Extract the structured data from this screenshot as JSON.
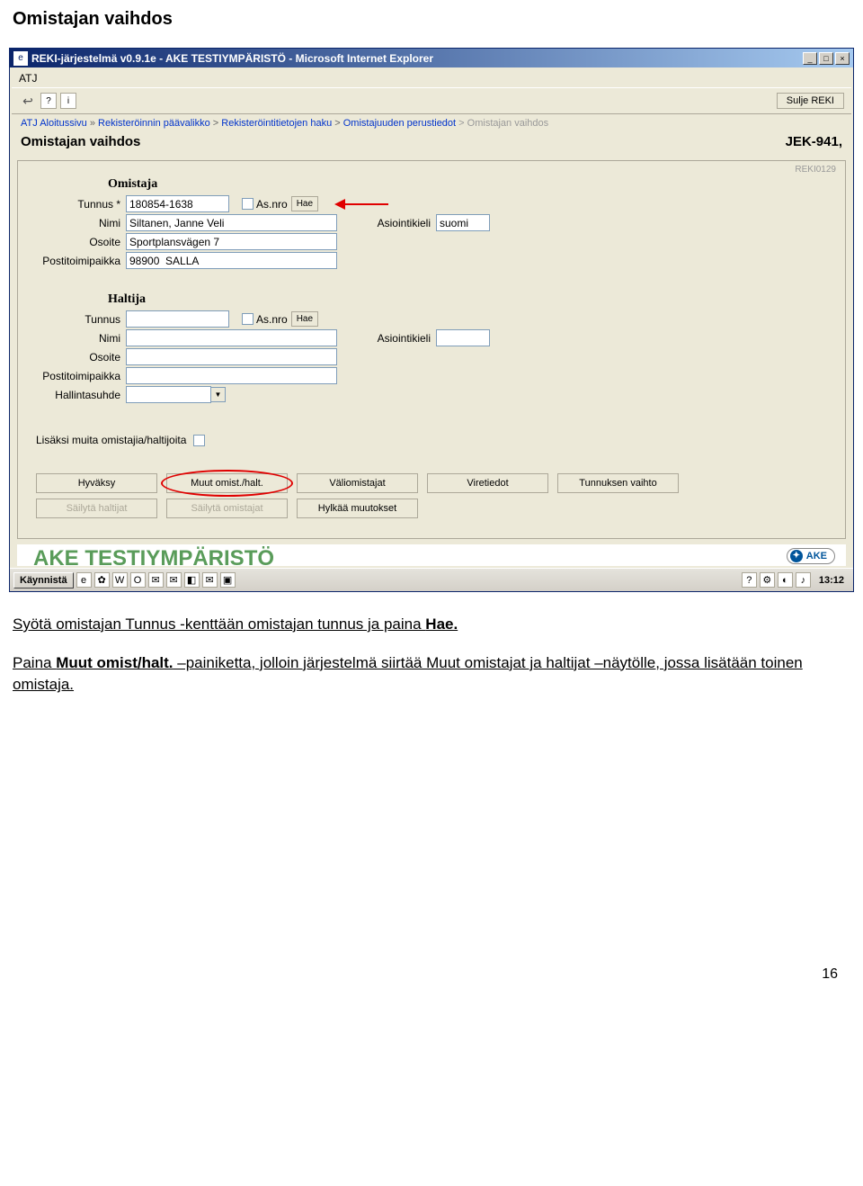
{
  "doc": {
    "heading": "Omistajan vaihdos",
    "page_number": "16"
  },
  "window": {
    "title": "REKI-järjestelmä v0.9.1e - AKE TESTIYMPÄRISTÖ - Microsoft Internet Explorer",
    "min": "_",
    "max": "□",
    "close": "×"
  },
  "menu": {
    "atj": "ATJ"
  },
  "toolbar": {
    "back_arrow": "↩",
    "q": "?",
    "i": "i",
    "sulje": "Sulje REKI"
  },
  "breadcrumb": {
    "seg1": "ATJ Aloitussivu",
    "sep": " » ",
    "seg2": "Rekisteröinnin päävalikko",
    "gt": " > ",
    "seg3": "Rekisteröintitietojen haku",
    "seg4": "Omistajuuden perustiedot",
    "seg5": "Omistajan vaihdos"
  },
  "header": {
    "title": "Omistajan vaihdos",
    "plate": "JEK-941,",
    "panel_code": "REKI0129"
  },
  "omistaja": {
    "section": "Omistaja",
    "tunnus_label": "Tunnus *",
    "tunnus_value": "180854-1638",
    "asnro_label": "As.nro",
    "hae": "Hae",
    "nimi_label": "Nimi",
    "nimi_value": "Siltanen, Janne Veli",
    "kieli_label": "Asiointikieli",
    "kieli_value": "suomi",
    "osoite_label": "Osoite",
    "osoite_value": "Sportplansvägen 7",
    "posti_label": "Postitoimipaikka",
    "posti_value": "98900  SALLA"
  },
  "haltija": {
    "section": "Haltija",
    "tunnus_label": "Tunnus",
    "tunnus_value": "",
    "asnro_label": "As.nro",
    "hae": "Hae",
    "nimi_label": "Nimi",
    "nimi_value": "",
    "kieli_label": "Asiointikieli",
    "kieli_value": "",
    "osoite_label": "Osoite",
    "osoite_value": "",
    "posti_label": "Postitoimipaikka",
    "posti_value": "",
    "hallinta_label": "Hallintasuhde",
    "hallinta_value": ""
  },
  "extras": {
    "label": "Lisäksi muita omistajia/haltijoita"
  },
  "buttons": {
    "hyvaksy": "Hyväksy",
    "muut": "Muut omist./halt.",
    "valio": "Väliomistajat",
    "vire": "Viretiedot",
    "tunnuksen": "Tunnuksen vaihto",
    "sailyta_h": "Säilytä haltijat",
    "sailyta_o": "Säilytä omistajat",
    "hylkaa": "Hylkää muutokset"
  },
  "watermark": "AKE TESTIYMPÄRISTÖ",
  "ake_logo": "AKE",
  "taskbar": {
    "start": "Käynnistä",
    "clock": "13:12"
  },
  "instructions": {
    "p1a": "Syötä omistajan Tunnus -kenttään omistajan tunnus ja paina ",
    "p1b": "Hae.",
    "p2a": "Paina ",
    "p2b": "Muut omist/halt.",
    "p2c": " –painiketta, jolloin järjestelmä siirtää Muut omistajat ja haltijat –näytölle, jossa lisätään toinen omistaja."
  }
}
